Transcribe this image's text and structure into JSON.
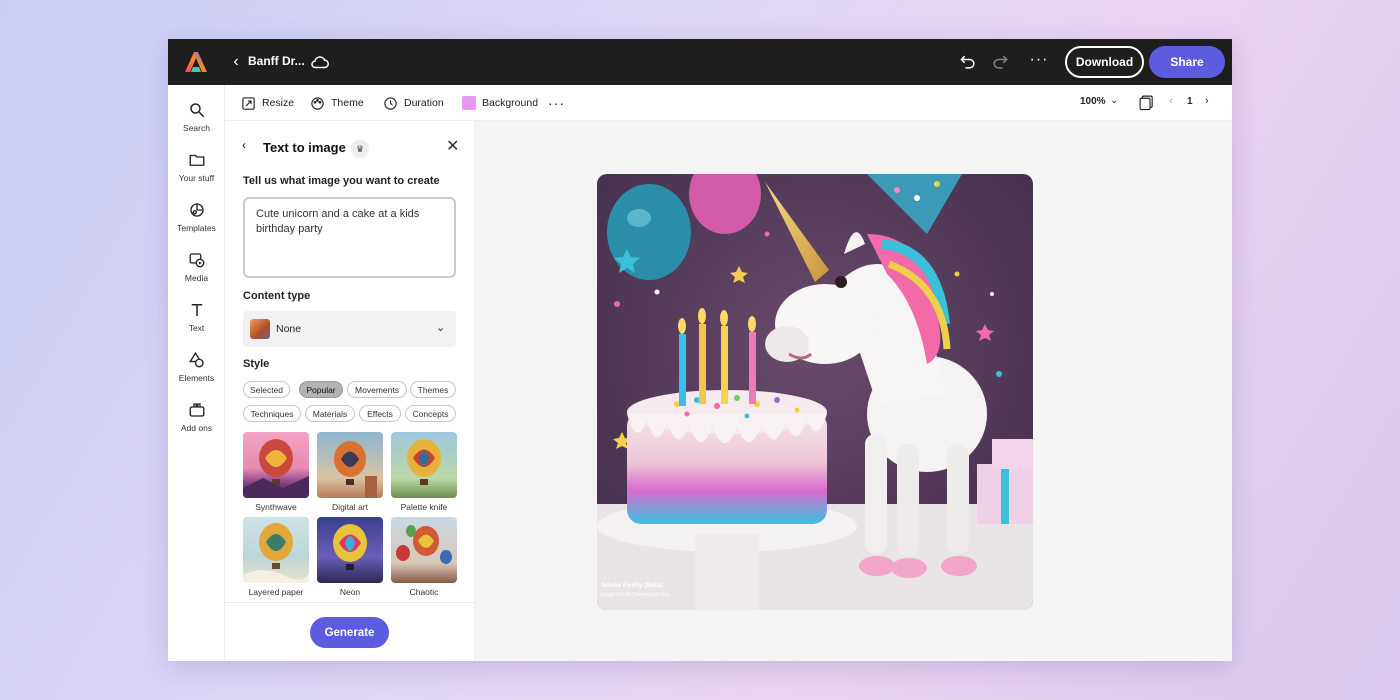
{
  "topbar": {
    "doc_title": "Banff Dr...",
    "download_label": "Download",
    "share_label": "Share",
    "more_label": "···"
  },
  "rail": {
    "items": [
      {
        "label": "Search",
        "icon": "search-icon"
      },
      {
        "label": "Your stuff",
        "icon": "folder-icon"
      },
      {
        "label": "Templates",
        "icon": "templates-icon"
      },
      {
        "label": "Media",
        "icon": "media-icon"
      },
      {
        "label": "Text",
        "icon": "text-icon"
      },
      {
        "label": "Elements",
        "icon": "elements-icon"
      },
      {
        "label": "Add ons",
        "icon": "addons-icon"
      }
    ]
  },
  "toolbar": {
    "resize": "Resize",
    "theme": "Theme",
    "duration": "Duration",
    "background": "Background",
    "background_color": "#e49af0",
    "more": "···",
    "zoom": "100%",
    "page": "1"
  },
  "panel": {
    "title": "Text to image",
    "prompt_label": "Tell us what image you want to create",
    "prompt_value": "Cute unicorn and a cake at a kids birthday party",
    "content_type_label": "Content type",
    "content_type_value": "None",
    "style_label": "Style",
    "chips": [
      {
        "label": "Selected",
        "active": false
      },
      {
        "label": "Popular",
        "active": true
      },
      {
        "label": "Movements",
        "active": false
      },
      {
        "label": "Themes",
        "active": false
      },
      {
        "label": "Techniques",
        "active": false
      },
      {
        "label": "Materials",
        "active": false
      },
      {
        "label": "Effects",
        "active": false
      },
      {
        "label": "Concepts",
        "active": false
      }
    ],
    "styles": [
      {
        "label": "Synthwave"
      },
      {
        "label": "Digital art"
      },
      {
        "label": "Palette knife"
      },
      {
        "label": "Layered paper"
      },
      {
        "label": "Neon"
      },
      {
        "label": "Chaotic"
      }
    ],
    "generate_label": "Generate"
  },
  "canvas": {
    "badge_title": "Adobe Firefly (Beta)",
    "badge_sub": "Image Not for Commercial Use"
  },
  "colors": {
    "accent": "#5c5ce0",
    "topbar": "#1e1e1e"
  }
}
